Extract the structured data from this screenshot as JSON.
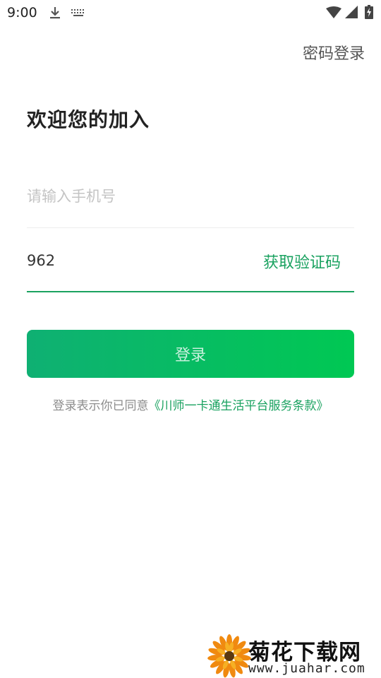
{
  "status_bar": {
    "time": "9:00",
    "icons": [
      "download-icon",
      "keyboard-icon",
      "wifi-icon",
      "signal-icon",
      "battery-icon"
    ]
  },
  "header": {
    "password_login": "密码登录"
  },
  "page": {
    "title": "欢迎您的加入"
  },
  "form": {
    "phone_placeholder": "请输入手机号",
    "phone_value": "",
    "code_value": "962",
    "get_code_label": "获取验证码",
    "login_label": "登录"
  },
  "agreement": {
    "prefix": "登录表示你已同意",
    "link": "《川师一卡通生活平台服务条款》"
  },
  "watermark": {
    "name": "菊花下载网",
    "url": "www.juahar.com"
  },
  "colors": {
    "accent": "#1aa260",
    "button_start": "#0fb073",
    "button_end": "#00c853",
    "placeholder": "#c4c4c4",
    "muted_text": "#8c8c8c"
  }
}
